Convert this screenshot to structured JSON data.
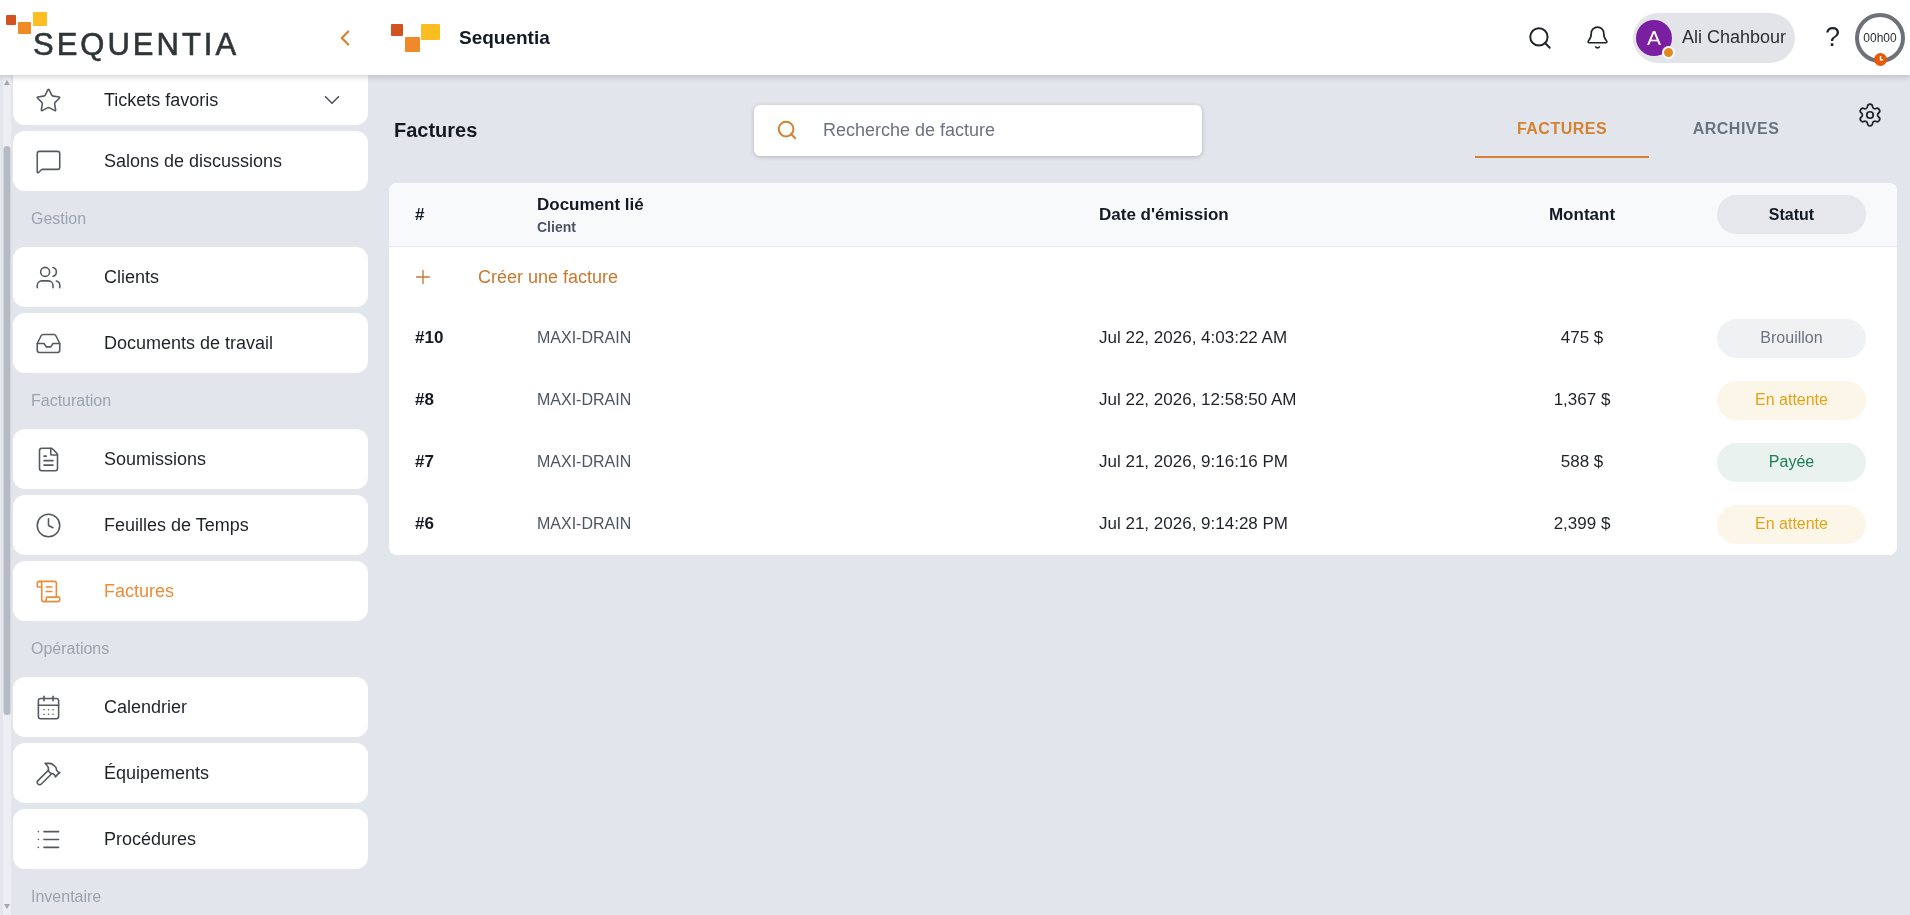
{
  "header": {
    "brand_name": "SEQUENTIA",
    "app_name": "Sequentia",
    "user": {
      "initial": "A",
      "name": "Ali Chahbour"
    },
    "help": "?",
    "timer": "00h00"
  },
  "sidebar": {
    "favorites": {
      "label": "Tickets favoris",
      "expanded": false
    },
    "sections": [
      {
        "items": [
          {
            "label": "Salons de discussions",
            "selected": false
          }
        ]
      },
      {
        "title": "Gestion",
        "items": [
          {
            "label": "Clients",
            "selected": false
          },
          {
            "label": "Documents de travail",
            "selected": false
          }
        ]
      },
      {
        "title": "Facturation",
        "items": [
          {
            "label": "Soumissions",
            "selected": false
          },
          {
            "label": "Feuilles de Temps",
            "selected": false
          },
          {
            "label": "Factures",
            "selected": true
          }
        ]
      },
      {
        "title": "Opérations",
        "items": [
          {
            "label": "Calendrier",
            "selected": false
          },
          {
            "label": "Équipements",
            "selected": false
          },
          {
            "label": "Procédures",
            "selected": false
          }
        ]
      },
      {
        "title": "Inventaire"
      }
    ]
  },
  "page": {
    "title": "Factures",
    "search": {
      "placeholder": "Recherche de facture"
    },
    "tabs": [
      {
        "label": "FACTURES",
        "selected": true
      },
      {
        "label": "ARCHIVES",
        "selected": false
      }
    ]
  },
  "table": {
    "columns": [
      {
        "label": "#",
        "kind": "text"
      },
      {
        "label": "Document lié",
        "sublabel": "Client",
        "kind": "text"
      },
      {
        "label": "Date d'émission",
        "kind": "text"
      },
      {
        "label": "Montant",
        "kind": "text"
      },
      {
        "label": "Statut",
        "kind": "pill"
      }
    ],
    "create_label": "Créer une facture",
    "rows": [
      {
        "number": "#10",
        "client": "MAXI-DRAIN",
        "date": "Jul 22, 2026, 4:03:22 AM",
        "amount": "475 $",
        "status": {
          "label": "Brouillon",
          "color": "#6b7280"
        }
      },
      {
        "number": "#8",
        "client": "MAXI-DRAIN",
        "date": "Jul 22, 2026, 12:58:50 AM",
        "amount": "1,367 $",
        "status": {
          "label": "En attente",
          "color": "#e3a21a"
        }
      },
      {
        "number": "#7",
        "client": "MAXI-DRAIN",
        "date": "Jul 21, 2026, 9:16:16 PM",
        "amount": "588 $",
        "status": {
          "label": "Payée",
          "color": "#1e7d57"
        }
      },
      {
        "number": "#6",
        "client": "MAXI-DRAIN",
        "date": "Jul 21, 2026, 9:14:28 PM",
        "amount": "2,399 $",
        "status": {
          "label": "En attente",
          "color": "#e3a21a"
        }
      }
    ]
  }
}
